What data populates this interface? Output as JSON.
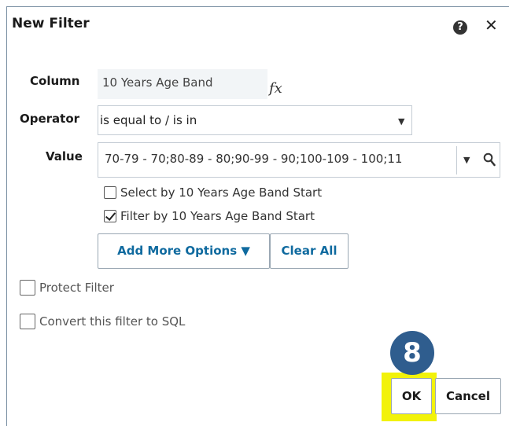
{
  "dialog": {
    "title": "New Filter",
    "help_icon": "question-icon",
    "close_icon": "close-icon"
  },
  "form": {
    "column_label": "Column",
    "column_value": "10 Years Age Band",
    "fx_label": "fx",
    "operator_label": "Operator",
    "operator_value": "is equal to / is in",
    "value_label": "Value",
    "value_value": "70-79 - 70;80-89 - 80;90-99 - 90;100-109 - 100;11"
  },
  "options": {
    "select_by": {
      "label": "Select by 10 Years Age Band Start",
      "checked": false
    },
    "filter_by": {
      "label": "Filter by 10 Years Age Band Start",
      "checked": true
    },
    "add_more_label": "Add More Options ▼",
    "clear_all_label": "Clear All",
    "protect_filter": {
      "label": "Protect Filter",
      "checked": false
    },
    "convert_sql": {
      "label": "Convert this filter to SQL",
      "checked": false
    }
  },
  "footer": {
    "ok_label": "OK",
    "cancel_label": "Cancel"
  },
  "annotation": {
    "step_number": "8",
    "badge_color": "#2f5d8e",
    "highlight_color": "#f2f20a"
  }
}
